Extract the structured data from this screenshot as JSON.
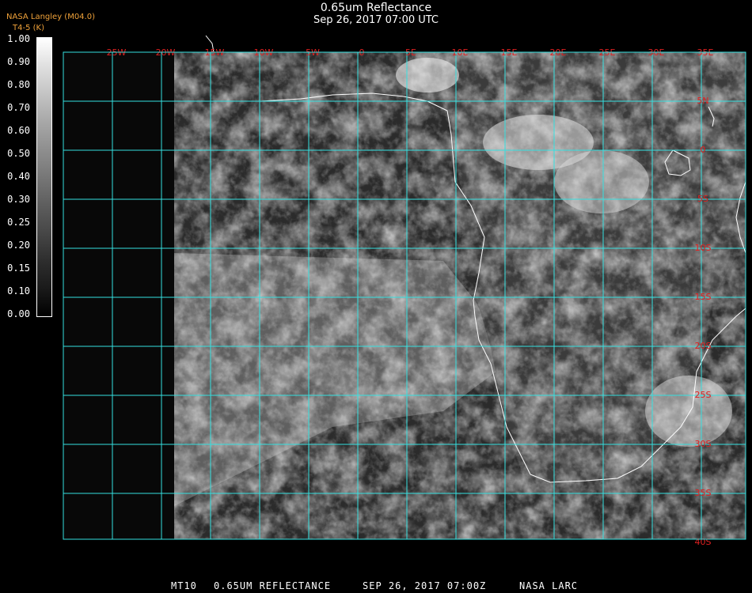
{
  "title": {
    "line1": "0.65um Reflectance",
    "line2": "Sep 26, 2017 07:00 UTC"
  },
  "credit": {
    "line1": "NASA Langley (M04.0)",
    "line2": "T4-5 (K)",
    "overlap": "0.65"
  },
  "colorbar": {
    "ticks": [
      "1.00",
      "0.90",
      "0.80",
      "0.70",
      "0.60",
      "0.50",
      "0.40",
      "0.30",
      "0.25",
      "0.20",
      "0.15",
      "0.10",
      "0.00"
    ]
  },
  "map": {
    "lon_labels": [
      "25W",
      "20W",
      "15W",
      "10W",
      "5W",
      "0",
      "5E",
      "10E",
      "15E",
      "20E",
      "25E",
      "30E",
      "35E"
    ],
    "lat_labels": [
      "5N",
      "0",
      "5S",
      "10S",
      "15S",
      "20S",
      "25S",
      "30S",
      "35S",
      "40S"
    ],
    "grid_color": "#35e0e0",
    "label_color": "#e02020",
    "coast_color": "#ffffff"
  },
  "footer": {
    "sat": "MT10",
    "product": "0.65UM REFLECTANCE",
    "date": "SEP 26, 2017 07:00Z",
    "source": "NASA LARC"
  }
}
